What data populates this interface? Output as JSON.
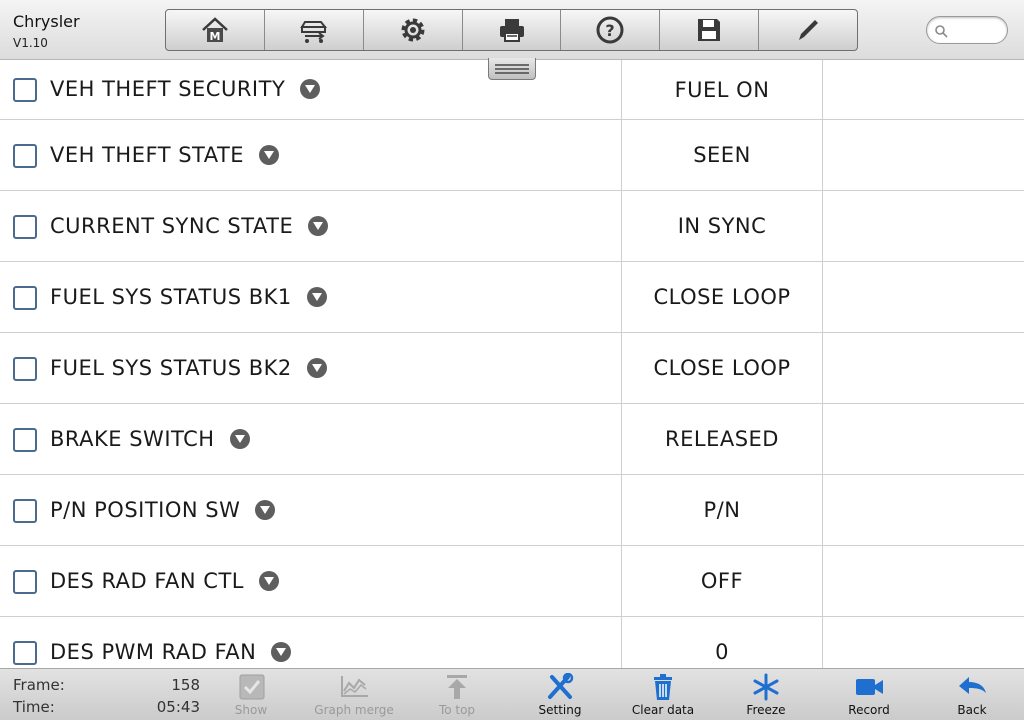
{
  "header": {
    "app_title": "Chrysler",
    "version": "V1.10",
    "toolbar": [
      {
        "name": "home",
        "icon": "home-m-icon"
      },
      {
        "name": "vehicle-swap",
        "icon": "vehicle-swap-icon"
      },
      {
        "name": "settings",
        "icon": "gear-icon"
      },
      {
        "name": "print",
        "icon": "printer-icon"
      },
      {
        "name": "help",
        "icon": "help-icon"
      },
      {
        "name": "save",
        "icon": "floppy-disk-icon"
      },
      {
        "name": "edit",
        "icon": "pencil-icon"
      }
    ],
    "search": {
      "value": "",
      "placeholder": ""
    }
  },
  "rows": [
    {
      "label": "VEH THEFT SECURITY",
      "value": "FUEL ON",
      "unit": ""
    },
    {
      "label": "VEH THEFT STATE",
      "value": "SEEN",
      "unit": ""
    },
    {
      "label": "CURRENT SYNC STATE",
      "value": "IN SYNC",
      "unit": ""
    },
    {
      "label": "FUEL SYS STATUS BK1",
      "value": "CLOSE LOOP",
      "unit": ""
    },
    {
      "label": "FUEL SYS STATUS BK2",
      "value": "CLOSE LOOP",
      "unit": ""
    },
    {
      "label": "BRAKE SWITCH",
      "value": "RELEASED",
      "unit": ""
    },
    {
      "label": "P/N POSITION SW",
      "value": "P/N",
      "unit": ""
    },
    {
      "label": "DES RAD FAN CTL",
      "value": "OFF",
      "unit": ""
    },
    {
      "label": "DES PWM RAD FAN",
      "value": "0",
      "unit": ""
    }
  ],
  "footer": {
    "frame_label": "Frame:",
    "frame_value": "158",
    "time_label": "Time:",
    "time_value": "05:43",
    "buttons": [
      {
        "label": "Show",
        "icon": "check-square-icon",
        "enabled": false
      },
      {
        "label": "Graph merge",
        "icon": "graph-merge-icon",
        "enabled": false
      },
      {
        "label": "To top",
        "icon": "arrow-top-icon",
        "enabled": false
      },
      {
        "label": "Setting",
        "icon": "tools-icon",
        "enabled": true
      },
      {
        "label": "Clear data",
        "icon": "trash-icon",
        "enabled": true
      },
      {
        "label": "Freeze",
        "icon": "snowflake-icon",
        "enabled": true
      },
      {
        "label": "Record",
        "icon": "video-camera-icon",
        "enabled": true
      },
      {
        "label": "Back",
        "icon": "back-arrow-icon",
        "enabled": true
      }
    ]
  },
  "colors": {
    "accent_blue": "#1f6fd1",
    "disabled_gray": "#9a9a9a",
    "checkbox_border": "#4a6b8c",
    "row_divider": "#cfcfcf"
  }
}
